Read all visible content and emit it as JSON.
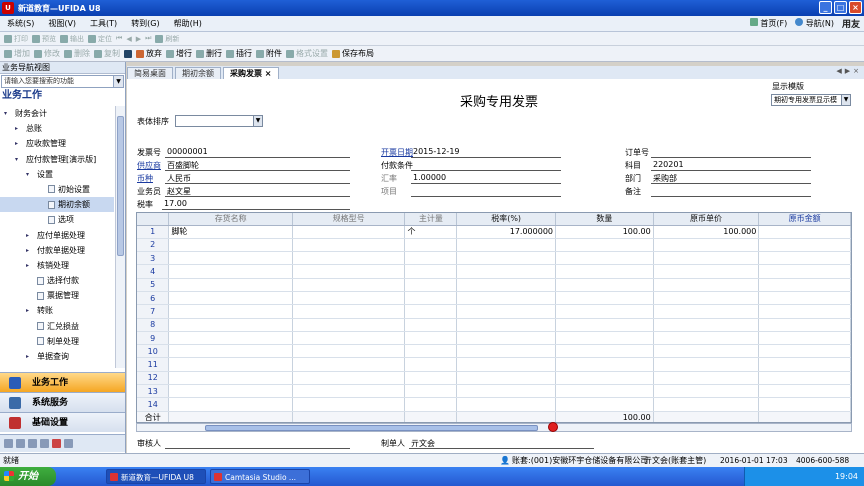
{
  "window": {
    "title": "新道教育—UFIDA U8"
  },
  "menu": {
    "items": [
      "系统(S)",
      "视图(V)",
      "工具(T)",
      "转到(G)",
      "帮助(H)"
    ],
    "home": "首页(F)",
    "nav": "导航(N)",
    "brand": "用友"
  },
  "toolbar1": {
    "items": [
      "打印",
      "预览",
      "输出",
      "定位",
      "刷新"
    ]
  },
  "toolbar2": {
    "items": [
      "增加",
      "修改",
      "删除",
      "复制",
      "放弃",
      "增行",
      "删行",
      "插行",
      "附件",
      "格式设置",
      "保存布局"
    ]
  },
  "sidebar": {
    "header": "业务导航视图",
    "search_placeholder": "请输入您要搜索的功能",
    "section": "业务工作",
    "tree": [
      {
        "label": "财务会计",
        "level": 0,
        "arrow": "▾"
      },
      {
        "label": "总账",
        "level": 1,
        "arrow": "▸"
      },
      {
        "label": "应收款管理",
        "level": 1,
        "arrow": "▸"
      },
      {
        "label": "应付款管理[演示版]",
        "level": 1,
        "arrow": "▾"
      },
      {
        "label": "设置",
        "level": 2,
        "arrow": "▾"
      },
      {
        "label": "初始设置",
        "level": 3,
        "doc": true
      },
      {
        "label": "期初余额",
        "level": 3,
        "doc": true,
        "selected": true
      },
      {
        "label": "选项",
        "level": 3,
        "doc": true
      },
      {
        "label": "应付单据处理",
        "level": 2,
        "arrow": "▸"
      },
      {
        "label": "付款单据处理",
        "level": 2,
        "arrow": "▸"
      },
      {
        "label": "核销处理",
        "level": 2,
        "arrow": "▸"
      },
      {
        "label": "选择付款",
        "level": 2,
        "doc": true
      },
      {
        "label": "票据管理",
        "level": 2,
        "doc": true
      },
      {
        "label": "转账",
        "level": 2,
        "arrow": "▸"
      },
      {
        "label": "汇兑损益",
        "level": 2,
        "doc": true
      },
      {
        "label": "制单处理",
        "level": 2,
        "doc": true
      },
      {
        "label": "单据查询",
        "level": 2,
        "arrow": "▸"
      }
    ],
    "nav_buttons": [
      "业务工作",
      "系统服务",
      "基础设置"
    ]
  },
  "tabs": [
    "简易桌面",
    "期初余额",
    "采购发票"
  ],
  "form": {
    "title": "采购专用发票",
    "template_label": "显示模版",
    "template_value": "期初专用发票显示模",
    "sort_label": "表体排序",
    "invoice_no_label": "发票号",
    "invoice_no": "00000001",
    "date_label": "开票日期",
    "date": "2015-12-19",
    "order_label": "订单号",
    "order": "",
    "supplier_label": "供应商",
    "supplier": "百盛脚轮",
    "payterm_label": "付款条件",
    "payterm": "",
    "subject_label": "科目",
    "subject": "220201",
    "currency_label": "币种",
    "currency": "人民币",
    "rate_label": "汇率",
    "rate": "1.00000",
    "dept_label": "部门",
    "dept": "采购部",
    "clerk_label": "业务员",
    "clerk": "赵文星",
    "project_label": "项目",
    "project": "",
    "remark_label": "备注",
    "remark": "",
    "tax_label": "税率",
    "tax": "17.00",
    "auditor_label": "审核人",
    "auditor": "",
    "maker_label": "制单人",
    "maker": "亓文会"
  },
  "grid": {
    "headers": [
      "存货名称",
      "规格型号",
      "主计量",
      "税率(%)",
      "数量",
      "原币单价",
      "原币金额"
    ],
    "rows": [
      [
        "1",
        "脚轮",
        "",
        "个",
        "17.000000",
        "100.00",
        "100.000",
        ""
      ],
      [
        "2",
        "",
        "",
        "",
        "",
        "",
        "",
        ""
      ],
      [
        "3",
        "",
        "",
        "",
        "",
        "",
        "",
        ""
      ],
      [
        "4",
        "",
        "",
        "",
        "",
        "",
        "",
        ""
      ],
      [
        "5",
        "",
        "",
        "",
        "",
        "",
        "",
        ""
      ],
      [
        "6",
        "",
        "",
        "",
        "",
        "",
        "",
        ""
      ],
      [
        "7",
        "",
        "",
        "",
        "",
        "",
        "",
        ""
      ],
      [
        "8",
        "",
        "",
        "",
        "",
        "",
        "",
        ""
      ],
      [
        "9",
        "",
        "",
        "",
        "",
        "",
        "",
        ""
      ],
      [
        "10",
        "",
        "",
        "",
        "",
        "",
        "",
        ""
      ],
      [
        "11",
        "",
        "",
        "",
        "",
        "",
        "",
        ""
      ],
      [
        "12",
        "",
        "",
        "",
        "",
        "",
        "",
        ""
      ],
      [
        "13",
        "",
        "",
        "",
        "",
        "",
        "",
        ""
      ],
      [
        "14",
        "",
        "",
        "",
        "",
        "",
        "",
        ""
      ]
    ],
    "total_label": "合计",
    "total_qty": "100.00"
  },
  "status": {
    "left": "就绪",
    "account": "账套:(001)安徽环宇仓储设备有限公司",
    "user": "亓文会(账套主管)",
    "date": "2016-01-01 17:03",
    "phone": "4006-600-588"
  },
  "taskbar": {
    "start": "开始",
    "tasks": [
      "新道教育—UFIDA U8",
      "Camtasia Studio ..."
    ],
    "clock": "19:04"
  }
}
